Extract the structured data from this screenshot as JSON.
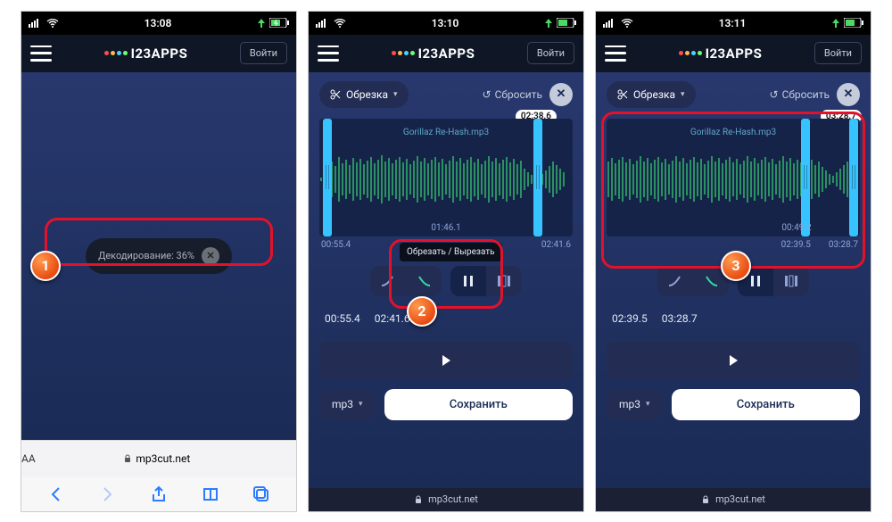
{
  "status": {
    "t1": "13:08",
    "t2": "13:10",
    "t3": "13:11"
  },
  "brand": {
    "name": "I23APPS"
  },
  "login_label": "Войти",
  "decode_text": "Декодирование: 36%",
  "trim_label": "Обрезка",
  "reset_label": "Сбросить",
  "filename": "Gorillaz Re-Hash.mp3",
  "tooltip_cut": "Обрезать / Вырезать",
  "play_fmt": "mp3",
  "save_label": "Сохранить",
  "url_host": "mp3cut.net",
  "p2": {
    "badge_end": "02:38.6",
    "wave_center": "01:46.1",
    "ruler_a": "00:55.4",
    "ruler_b": "02:41.6",
    "start_t": "00:55.4",
    "end_t": "02:41.6"
  },
  "p3": {
    "badge_end": "03:28.7",
    "wave_center": "00:49.2",
    "ruler_a": "02:39.5",
    "ruler_b": "03:28.7",
    "start_t": "02:39.5",
    "end_t": "03:28.7"
  },
  "steps": {
    "s1": "1",
    "s2": "2",
    "s3": "3"
  }
}
